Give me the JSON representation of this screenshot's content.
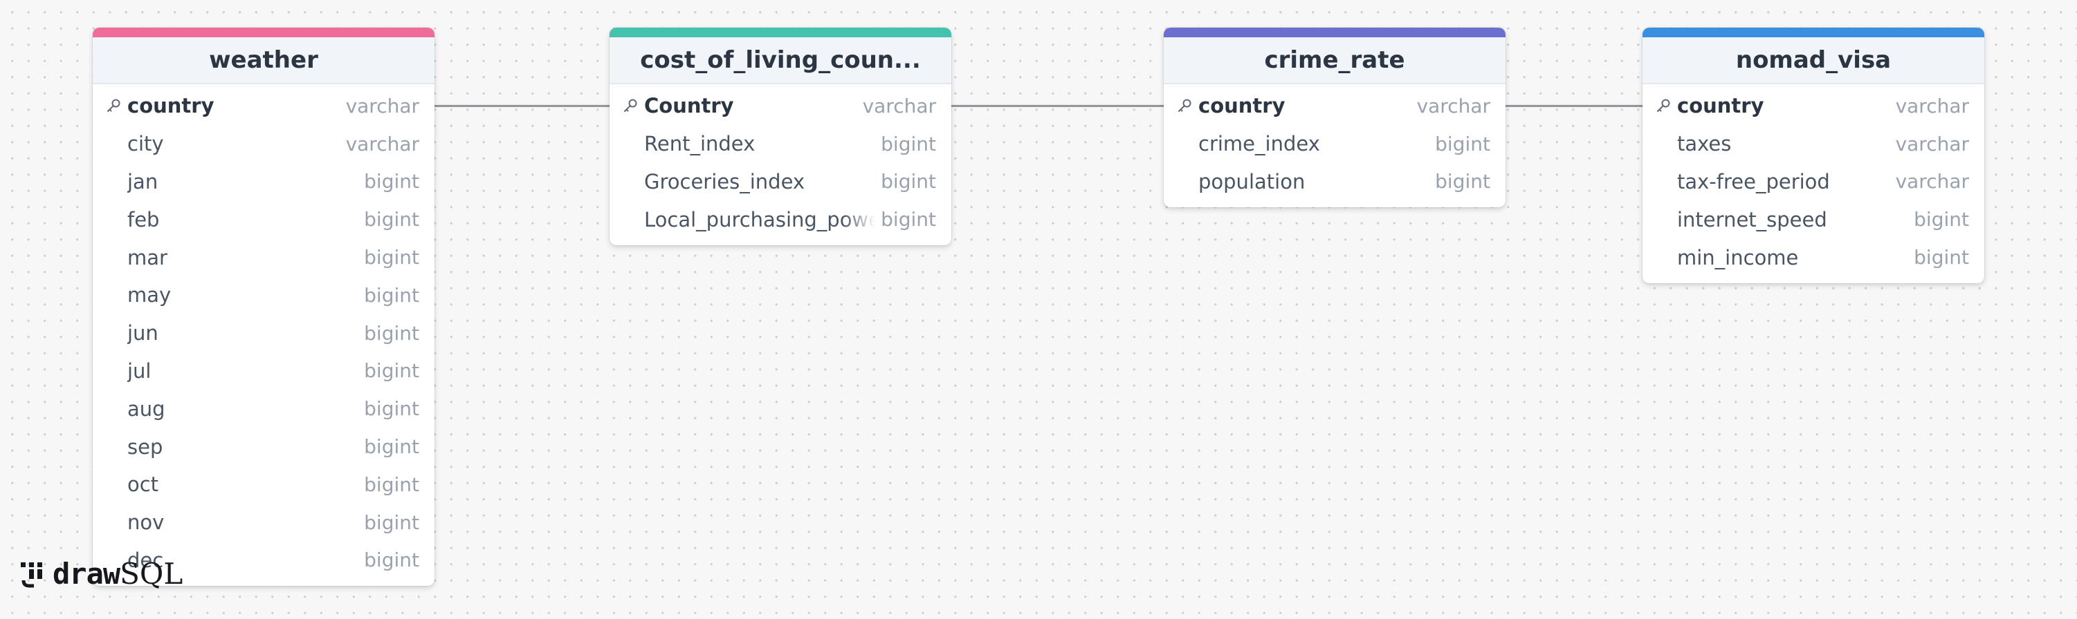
{
  "app": {
    "logo_prefix": "draw",
    "logo_suffix": "SQL"
  },
  "tables": [
    {
      "name": "weather",
      "accent_color": "#ef6b98",
      "columns": [
        {
          "name": "country",
          "type": "varchar",
          "primary_key": true
        },
        {
          "name": "city",
          "type": "varchar",
          "primary_key": false
        },
        {
          "name": "jan",
          "type": "bigint",
          "primary_key": false
        },
        {
          "name": "feb",
          "type": "bigint",
          "primary_key": false
        },
        {
          "name": "mar",
          "type": "bigint",
          "primary_key": false
        },
        {
          "name": "may",
          "type": "bigint",
          "primary_key": false
        },
        {
          "name": "jun",
          "type": "bigint",
          "primary_key": false
        },
        {
          "name": "jul",
          "type": "bigint",
          "primary_key": false
        },
        {
          "name": "aug",
          "type": "bigint",
          "primary_key": false
        },
        {
          "name": "sep",
          "type": "bigint",
          "primary_key": false
        },
        {
          "name": "oct",
          "type": "bigint",
          "primary_key": false
        },
        {
          "name": "nov",
          "type": "bigint",
          "primary_key": false
        },
        {
          "name": "dec",
          "type": "bigint",
          "primary_key": false
        }
      ]
    },
    {
      "name": "cost_of_living_coun...",
      "accent_color": "#45c2ae",
      "columns": [
        {
          "name": "Country",
          "type": "varchar",
          "primary_key": true
        },
        {
          "name": "Rent_index",
          "type": "bigint",
          "primary_key": false
        },
        {
          "name": "Groceries_index",
          "type": "bigint",
          "primary_key": false
        },
        {
          "name": "Local_purchasing_power",
          "type": "bigint",
          "primary_key": false
        }
      ]
    },
    {
      "name": "crime_rate",
      "accent_color": "#6b70cf",
      "columns": [
        {
          "name": "country",
          "type": "varchar",
          "primary_key": true
        },
        {
          "name": "crime_index",
          "type": "bigint",
          "primary_key": false
        },
        {
          "name": "population",
          "type": "bigint",
          "primary_key": false
        }
      ]
    },
    {
      "name": "nomad_visa",
      "accent_color": "#3b8fdf",
      "columns": [
        {
          "name": "country",
          "type": "varchar",
          "primary_key": true
        },
        {
          "name": "taxes",
          "type": "varchar",
          "primary_key": false
        },
        {
          "name": "tax-free_period",
          "type": "varchar",
          "primary_key": false
        },
        {
          "name": "internet_speed",
          "type": "bigint",
          "primary_key": false
        },
        {
          "name": "min_income",
          "type": "bigint",
          "primary_key": false
        }
      ]
    }
  ],
  "relationships": [
    {
      "from_table": 0,
      "from_column": 0,
      "to_table": 1,
      "to_column": 0
    },
    {
      "from_table": 1,
      "from_column": 0,
      "to_table": 2,
      "to_column": 0
    },
    {
      "from_table": 2,
      "from_column": 0,
      "to_table": 3,
      "to_column": 0
    }
  ]
}
